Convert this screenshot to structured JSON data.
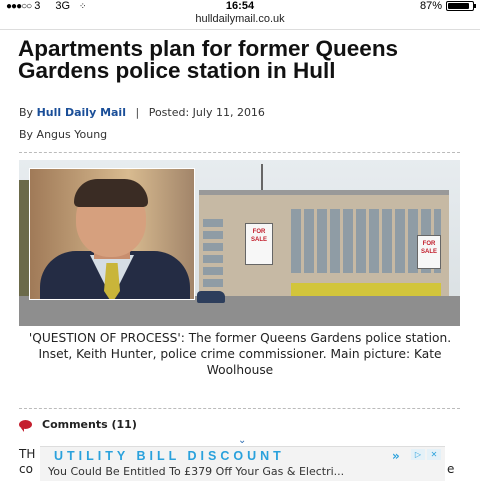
{
  "status_bar": {
    "signal_dots": "●●●○○",
    "carrier": "3",
    "network": "3G",
    "time": "16:54",
    "battery": "87%",
    "battery_level": 0.87
  },
  "url": "hulldailymail.co.uk",
  "article": {
    "headline": "Apartments plan for former Queens Gardens police station in Hull",
    "byline_prefix": "By",
    "publisher": "Hull Daily Mail",
    "separator": "|",
    "posted": "Posted: July 11, 2016",
    "author": "By Angus Young",
    "image": {
      "sign_text_1": "FOR SALE",
      "sign_text_2": "FOR SALE"
    },
    "caption": "'QUESTION OF PROCESS': The former Queens Gardens police station. Inset, Keith Hunter, police crime commissioner. Main picture: Kate Woolhouse",
    "comments_label": "Comments (11)",
    "body_start": "TH",
    "body_start_2": "co",
    "body_end": "e"
  },
  "ad": {
    "title": "UTILITY BILL DISCOUNT",
    "arrow": "»",
    "subtitle": "You Could Be Entitled To £379 Off Your Gas & Electri...",
    "icon_info": "▷",
    "icon_close": "✕"
  },
  "icons": {
    "comment": "comment-bubble-icon",
    "expand": "chevron-down-icon",
    "chevron": "⌄"
  }
}
